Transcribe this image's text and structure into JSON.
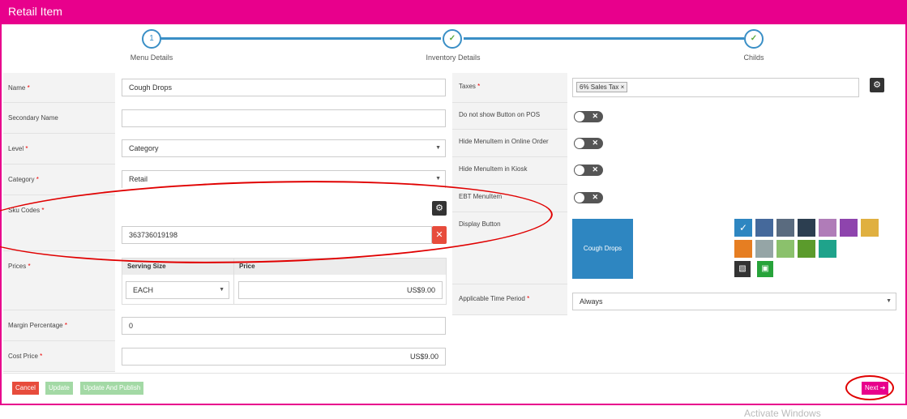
{
  "header": {
    "title": "Retail Item"
  },
  "stepper": {
    "steps": [
      {
        "number": "1",
        "label": "Menu Details"
      },
      {
        "label": "Inventory Details"
      },
      {
        "label": "Childs"
      }
    ]
  },
  "form": {
    "name_label": "Name",
    "name_value": "Cough Drops",
    "secondary_label": "Secondary Name",
    "secondary_value": "",
    "level_label": "Level",
    "level_value": "Category",
    "category_label": "Category",
    "category_value": "Retail",
    "sku_label": "Sku Codes",
    "sku_value": "363736019198",
    "prices_label": "Prices",
    "serving_size_header": "Serving Size",
    "price_header": "Price",
    "serving_size_value": "EACH",
    "price_value": "US$9.00",
    "margin_label": "Margin Percentage",
    "margin_value": "0",
    "cost_label": "Cost Price",
    "cost_value": "US$9.00",
    "required_mark": "*"
  },
  "right": {
    "taxes_label": "Taxes",
    "tax_tag": "6% Sales Tax",
    "tax_tag_remove": "×",
    "do_not_show_label": "Do not show Button on POS",
    "hide_online_label": "Hide MenuItem in Online Order",
    "hide_kiosk_label": "Hide MenuItem in Kiosk",
    "ebt_label": "EBT MenuItem",
    "display_button_label": "Display Button",
    "display_button_preview": "Cough Drops",
    "time_period_label": "Applicable Time Period",
    "time_period_value": "Always"
  },
  "colors": {
    "brand": "#e8008c",
    "step_blue": "#3a8fc6",
    "preview_bg": "#2e86c1",
    "swatches": [
      "#2e86c1",
      "#45699b",
      "#5a6b7f",
      "#2c3e50",
      "#b07cb8",
      "#8e44ad",
      "#e0b040",
      "#e67e22",
      "#95a5a6",
      "#8bc16c",
      "#5b9b2c",
      "#1fa38b"
    ]
  },
  "footer": {
    "cancel_label": "Cancel",
    "update_label": "Update",
    "update_publish_label": "Update And Publish",
    "next_label": "Next"
  },
  "watermark": {
    "text": "Activate Windows"
  }
}
